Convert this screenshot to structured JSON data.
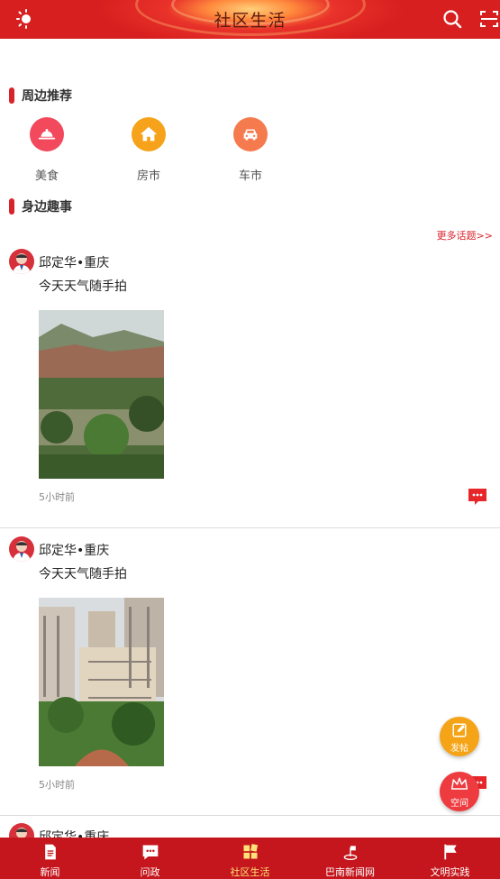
{
  "header": {
    "title": "社区生活",
    "bg_color": "#d81f1f",
    "left_icon": "light-icon",
    "right_icons": [
      "search-icon",
      "scan-icon"
    ]
  },
  "nearby": {
    "title": "周边推荐",
    "items": [
      {
        "label": "美食",
        "icon": "food-icon",
        "color": "#f2495c"
      },
      {
        "label": "房市",
        "icon": "house-icon",
        "color": "#f7a21b"
      },
      {
        "label": "车市",
        "icon": "car-icon",
        "color": "#f57a4d"
      }
    ]
  },
  "fun": {
    "title": "身边趣事",
    "more_label": "更多话题>>"
  },
  "posts": [
    {
      "author": "邱定华•重庆",
      "text": "今天天气随手拍",
      "time": "5小时前"
    },
    {
      "author": "邱定华•重庆",
      "text": "今天天气随手拍",
      "time": "5小时前"
    },
    {
      "author": "邱定华•重庆"
    }
  ],
  "fabs": {
    "post_label": "发帖",
    "space_label": "空间"
  },
  "bottom_nav": {
    "items": [
      {
        "label": "新闻",
        "icon": "news-icon"
      },
      {
        "label": "问政",
        "icon": "chat-icon"
      },
      {
        "label": "社区生活",
        "icon": "community-icon",
        "active": true
      },
      {
        "label": "巴南新闻网",
        "icon": "globe-pin-icon"
      },
      {
        "label": "文明实践",
        "icon": "flag-icon"
      }
    ]
  }
}
